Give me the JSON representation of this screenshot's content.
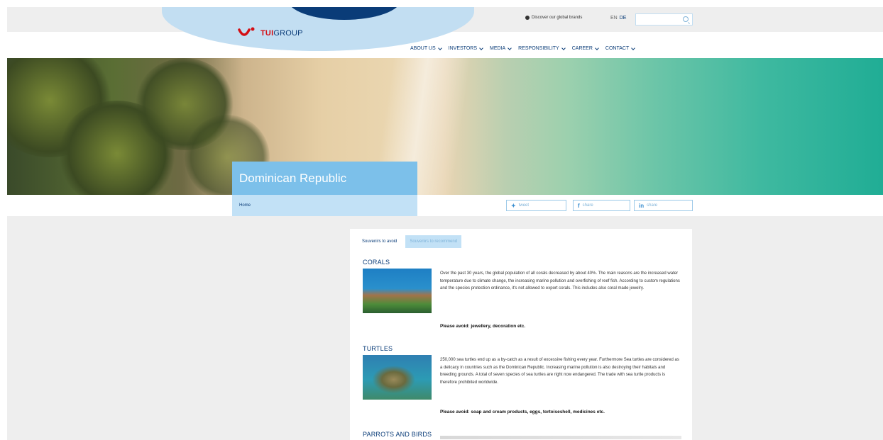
{
  "header": {
    "logo_brand": "TUI",
    "logo_suffix": "GROUP",
    "discover_link": "Discover our global brands",
    "lang_en": "EN",
    "lang_de": "DE",
    "search_placeholder": ""
  },
  "nav": [
    {
      "label": "ABOUT US"
    },
    {
      "label": "INVESTORS"
    },
    {
      "label": "MEDIA"
    },
    {
      "label": "RESPONSIBILITY"
    },
    {
      "label": "CAREER"
    },
    {
      "label": "CONTACT"
    }
  ],
  "hero": {
    "title": "Dominican Republic"
  },
  "breadcrumb": {
    "home": "Home"
  },
  "share": {
    "tweet": "tweet",
    "facebook": "share",
    "linkedin": "share"
  },
  "tabs": {
    "avoid": "Souvenirs to avoid",
    "recommend": "Souvenirs to recommend"
  },
  "sections": {
    "corals": {
      "title": "CORALS",
      "text": "Over the past 30 years, the global population of all corals decreased by about 40%.  The main reasons are the increased water temperature due to climate change, the increasing marine pollution and overfishing of reef fish. According to custom regulations and the species protection ordinance, it's not allowed to export corals. This includes also coral made jewelry.",
      "avoid": "Please avoid: jewellery, decoration etc."
    },
    "turtles": {
      "title": "TURTLES",
      "text": "250,000 sea turtles end up as a by-catch as a result of excessive fishing every year. Furthermore Sea turtles are considered as a delicacy in countries such as the Dominican Republic. Increasing marine pollution is also destroying their habitats and breeding grounds. A total of seven species of sea turtles are right now endangered. The trade with sea turtle products is therefore prohibited worldwide.",
      "avoid": "Please avoid: soap and cream products, eggs, tortoiseshell, medicines etc."
    },
    "parrots": {
      "title": "PARROTS AND BIRDS"
    }
  },
  "colors": {
    "brand_red": "#d40e14",
    "brand_navy": "#0a3c78",
    "accent_light_blue": "#7cc0ea",
    "accent_pale_blue": "#c2e1f6"
  }
}
